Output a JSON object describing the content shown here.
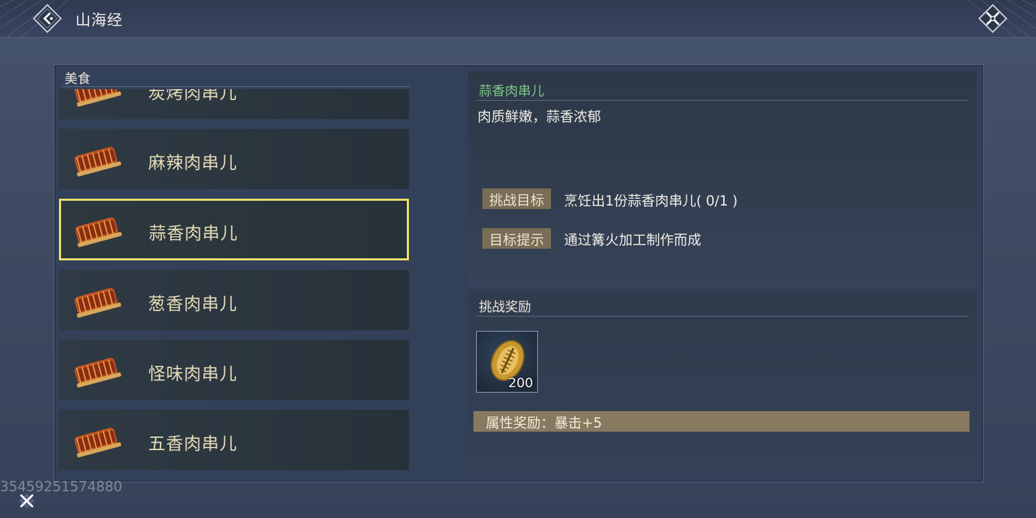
{
  "header": {
    "title": "山海经",
    "back_icon": "back-chevron-icon",
    "close_icon": "close-x-icon"
  },
  "list": {
    "header": "美食",
    "items": [
      {
        "label": "炭烤肉串儿",
        "icon": "meat-skewer-icon",
        "partial": true
      },
      {
        "label": "麻辣肉串儿",
        "icon": "meat-skewer-icon"
      },
      {
        "label": "蒜香肉串儿",
        "icon": "meat-skewer-icon",
        "selected": true
      },
      {
        "label": "葱香肉串儿",
        "icon": "meat-skewer-icon"
      },
      {
        "label": "怪味肉串儿",
        "icon": "meat-skewer-icon"
      },
      {
        "label": "五香肉串儿",
        "icon": "meat-skewer-icon"
      }
    ]
  },
  "detail": {
    "title": "蒜香肉串儿",
    "description": "肉质鲜嫩，蒜香浓郁",
    "goal_tag": "挑战目标",
    "goal_value": "烹饪出1份蒜香肉串儿( 0/1 )",
    "hint_tag": "目标提示",
    "hint_value": "通过篝火加工制作而成"
  },
  "rewards": {
    "title": "挑战奖励",
    "item": {
      "icon": "gold-shell-coin-icon",
      "count": "200"
    },
    "attribute": "属性奖励：暴击+5"
  },
  "watermark": "35459251574880",
  "colors": {
    "selected_border": "#f2e36a",
    "detail_title": "#7ec98c",
    "tag_bg": "#7a6d55",
    "attr_bar_bg": "#877a60"
  }
}
